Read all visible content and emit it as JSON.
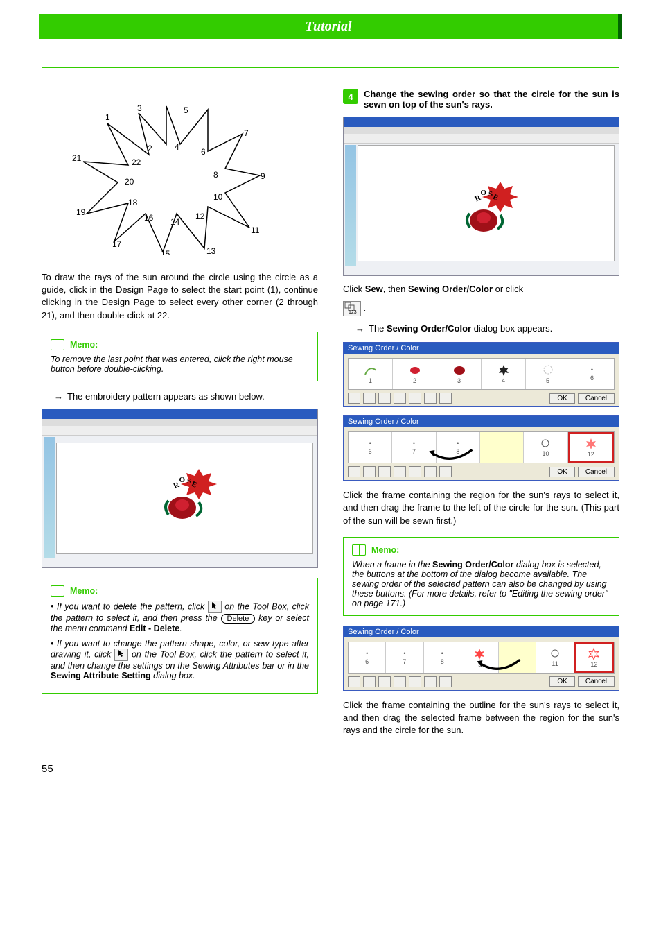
{
  "header": {
    "title": "Tutorial"
  },
  "pageNumber": "55",
  "starPoints": [
    "1",
    "2",
    "3",
    "4",
    "5",
    "6",
    "7",
    "8",
    "9",
    "10",
    "11",
    "12",
    "13",
    "14",
    "15",
    "16",
    "17",
    "18",
    "19",
    "20",
    "21",
    "22"
  ],
  "leftCol": {
    "intro": "To draw the rays of the sun around the circle using the circle as a guide, click in the Design Page to select the start point (1), continue clicking in the Design Page to select every other corner (2 through 21), and then double-click at 22.",
    "memo1": {
      "label": "Memo:",
      "text": "To remove the last point that was entered, click the right mouse button before double-clicking."
    },
    "result": "The embroidery pattern appears as shown below.",
    "roseLabel": "ROSE",
    "memo2": {
      "label": "Memo:",
      "bullet1a": "If you want to delete the pattern, click ",
      "bullet1b": " on the Tool Box, click the pattern to select it, and then press the ",
      "deleteKey": "Delete",
      "bullet1c": " key or select the menu command ",
      "editDeleteBold": "Edit - Delete",
      "bullet1d": ".",
      "bullet2a": "If you want to change the pattern shape, color, or sew type after drawing it, click ",
      "bullet2b": " on the Tool Box, click the pattern to select it, and then change the settings on the Sewing Attributes bar or in the ",
      "sewingAttrBold": "Sewing Attribute Setting",
      "bullet2c": " dialog box."
    }
  },
  "rightCol": {
    "stepNum": "4",
    "stepText": "Change the sewing order so that the circle for the sun is sewn on top of the sun's rays.",
    "roseLabel": "ROSE",
    "clickSewA": "Click ",
    "sewBold": "Sew",
    "clickSewB": ", then ",
    "sewingOrderColorBold": "Sewing Order/Color",
    "clickSewC": " or click ",
    "period": ".",
    "dialogAppearsA": "The ",
    "dialogAppearsBold": "Sewing Order/Color",
    "dialogAppearsB": " dialog box appears.",
    "dialog": {
      "title": "Sewing Order / Color",
      "frames1": [
        "1",
        "2",
        "3",
        "4",
        "5",
        "6"
      ],
      "frames2": [
        "6",
        "7",
        "8",
        "10",
        "12"
      ],
      "frames3": [
        "6",
        "7",
        "8",
        "9",
        "11",
        "12"
      ],
      "ok": "OK",
      "cancel": "Cancel"
    },
    "dragText": "Click the frame containing the region for the sun's rays to select it, and then drag the frame to the left of the circle for the sun. (This part of the sun will be sewn first.)",
    "memo": {
      "label": "Memo:",
      "textA": "When a frame in the ",
      "bold": "Sewing Order/Color",
      "textB": " dialog box is selected, the buttons at the bottom of the dialog become available. The sewing order of the selected pattern can also be changed by using these buttons. (For more details, refer to \"Editing the sewing order\" on page 171.)"
    },
    "finalText": "Click the frame containing the outline for the sun's rays to select it, and then drag the selected frame between the region for the sun's rays and the circle for the sun."
  }
}
